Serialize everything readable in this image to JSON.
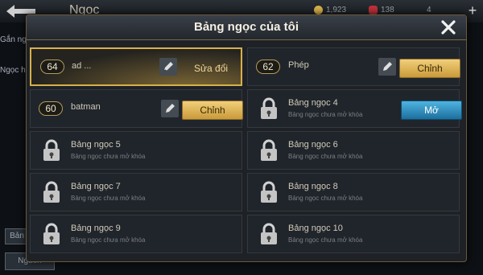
{
  "background": {
    "title": "Ngọc",
    "gold": "1,923",
    "gems": "138",
    "other": "4",
    "left_labels": [
      "Gắn ng",
      "Ngọc h"
    ],
    "bottom_buttons": [
      "Bản",
      "Nguồn"
    ]
  },
  "modal": {
    "title": "Bảng ngọc của tôi",
    "close_label": "✕"
  },
  "slots": [
    {
      "level": "64",
      "name": "ad ...",
      "action": "Sửa đổi",
      "style": "text",
      "active": true
    },
    {
      "level": "62",
      "name": "Phép",
      "action": "Chỉnh",
      "style": "gold"
    },
    {
      "level": "60",
      "name": "batman",
      "action": "Chỉnh",
      "style": "gold"
    },
    {
      "name": "Bảng ngọc 4",
      "sub": "Bảng ngọc chưa mở khóa",
      "action": "Mở",
      "style": "blue"
    },
    {
      "name": "Bảng ngọc 5",
      "sub": "Bảng ngọc chưa mở khóa"
    },
    {
      "name": "Bảng ngọc 6",
      "sub": "Bảng ngọc chưa mở khóa"
    },
    {
      "name": "Bảng ngọc 7",
      "sub": "Bảng ngọc chưa mở khóa"
    },
    {
      "name": "Bảng ngọc 8",
      "sub": "Bảng ngọc chưa mở khóa"
    },
    {
      "name": "Bảng ngọc 9",
      "sub": "Bảng ngọc chưa mở khóa"
    },
    {
      "name": "Bảng ngọc 10",
      "sub": "Bảng ngọc chưa mở khóa"
    }
  ],
  "colors": {
    "accent_gold": "#d8b04a",
    "unlock_blue": "#2a8cc0"
  }
}
